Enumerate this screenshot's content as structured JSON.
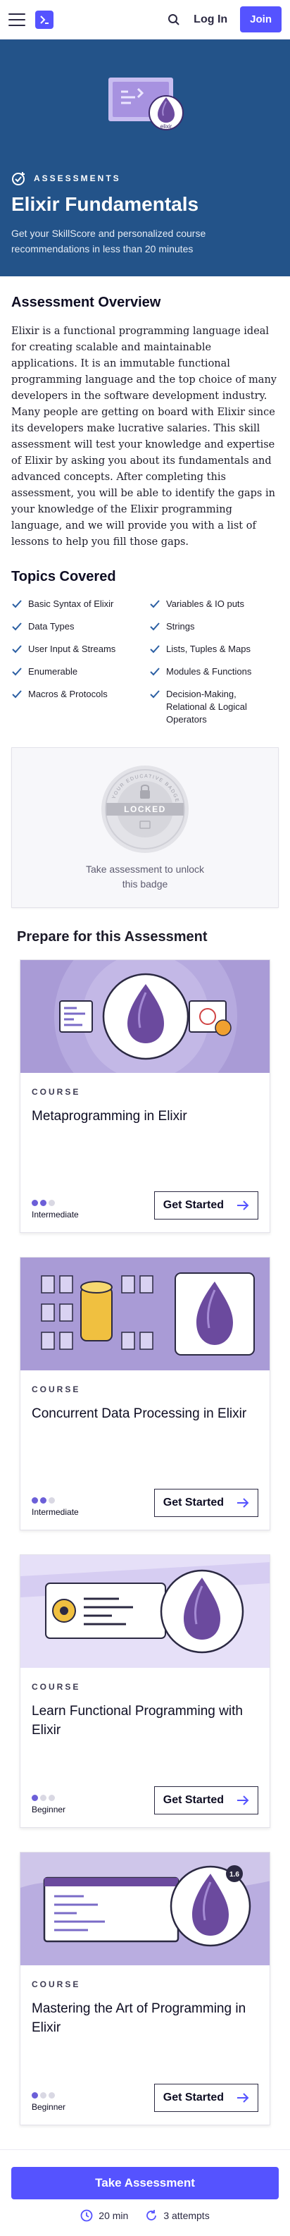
{
  "nav": {
    "login_label": "Log In",
    "join_label": "Join",
    "icons": [
      "menu-icon",
      "logo-icon",
      "search-icon"
    ]
  },
  "hero": {
    "badge_text": "elixir",
    "eyebrow": "ASSESSMENTS",
    "title": "Elixir Fundamentals",
    "subtitle": "Get your SkillScore and personalized course recommendations in less than 20 minutes"
  },
  "overview": {
    "heading": "Assessment Overview",
    "body": "Elixir is a functional programming language ideal for creating scalable and maintainable applications. It is an immutable functional programming language and the top choice of many developers in the software development industry. Many people are getting on board with Elixir since its developers make lucrative salaries. This skill assessment will test your knowledge and expertise of Elixir by asking you about its fundamentals and advanced concepts. After completing this assessment, you will be able to identify the gaps in your knowledge of the Elixir programming language, and we will provide you with a list of lessons to help you fill those gaps."
  },
  "topics": {
    "heading": "Topics Covered",
    "items": [
      "Basic Syntax of Elixir",
      "Variables & IO puts",
      "Data Types",
      "Strings",
      "User Input & Streams",
      "Lists, Tuples & Maps",
      "Enumerable",
      "Modules & Functions",
      "Macros & Protocols",
      "Decision-Making, Relational & Logical Operators"
    ]
  },
  "badge": {
    "ring_text": "YOUR EDUCATIVE BADGE",
    "locked_label": "LOCKED",
    "caption": "Take assessment to unlock this badge"
  },
  "prepare": {
    "heading": "Prepare for this Assessment",
    "courses": [
      {
        "eyebrow": "COURSE",
        "title": "Metaprogramming in Elixir",
        "level": "Intermediate",
        "level_value": 2,
        "cta": "Get Started"
      },
      {
        "eyebrow": "COURSE",
        "title": "Concurrent Data Processing in Elixir",
        "level": "Intermediate",
        "level_value": 2,
        "cta": "Get Started"
      },
      {
        "eyebrow": "COURSE",
        "title": "Learn Functional Programming with Elixir",
        "level": "Beginner",
        "level_value": 1,
        "cta": "Get Started"
      },
      {
        "eyebrow": "COURSE",
        "title": "Mastering the Art of Programming in Elixir",
        "level": "Beginner",
        "level_value": 1,
        "cta": "Get Started"
      }
    ],
    "image_badge_text": "1.6"
  },
  "bottom": {
    "cta": "Take Assessment",
    "duration": "20 min",
    "attempts": "3 attempts"
  },
  "colors": {
    "brand": "#5553ff",
    "hero_bg": "#235389",
    "course_art": "#a99bd6",
    "elixir_drop": "#6b4a9e"
  }
}
